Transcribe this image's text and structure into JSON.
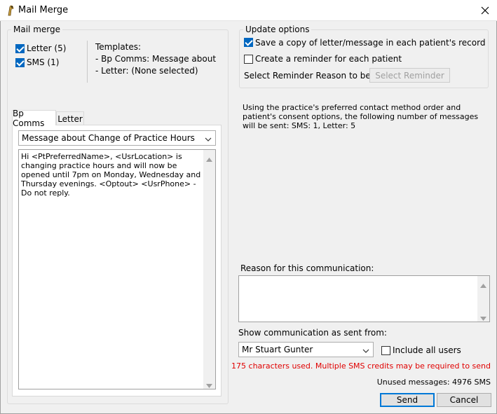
{
  "window": {
    "title": "Mail Merge"
  },
  "mail_merge": {
    "legend": "Mail merge",
    "letter_label": "Letter (5)",
    "letter_checked": true,
    "sms_label": "SMS  (1)",
    "sms_checked": true,
    "templates_header": "Templates:",
    "template_lines": [
      "- Bp Comms: Message about",
      "- Letter: (None selected)"
    ]
  },
  "tabs": [
    {
      "label": "Bp Comms",
      "active": true
    },
    {
      "label": "Letter",
      "active": false
    }
  ],
  "template_select": {
    "value": "Message about Change of Practice Hours"
  },
  "message_body": "Hi <PtPreferredName>, <UsrLocation> is changing practice hours and will now be opened until 7pm on Monday, Wednesday and Thursday evenings. <Optout> <UsrPhone> - Do not reply.",
  "update_options": {
    "legend": "Update options",
    "save_copy_label": "Save a copy of letter/message in each patient's record",
    "save_copy_checked": true,
    "create_reminder_label": "Create a reminder for each patient",
    "create_reminder_checked": false,
    "reminder_reason_label": "Select Reminder Reason to be used:",
    "select_reminder_button": "Select Reminder"
  },
  "info_text": "Using the practice's preferred contact method order and patient's consent options, the following number of messages will be sent: SMS: 1, Letter: 5",
  "reason": {
    "label": "Reason for this communication:",
    "value": ""
  },
  "sent_from": {
    "label": "Show communication as sent from:",
    "value": "Mr Stuart Gunter",
    "include_all_users_label": "Include all users",
    "include_all_users_checked": false
  },
  "warning_text": "175 characters used. Multiple SMS credits may be required to send",
  "unused_messages": "Unused messages: 4976 SMS",
  "buttons": {
    "send": "Send",
    "cancel": "Cancel"
  },
  "colors": {
    "accent": "#0067c0",
    "warning": "#e00000"
  }
}
